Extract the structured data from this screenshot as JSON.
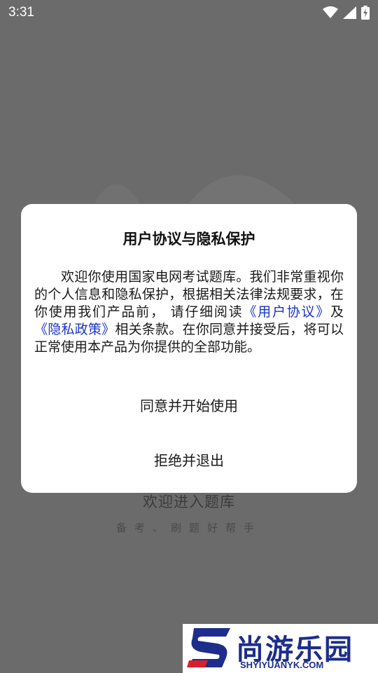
{
  "status_bar": {
    "time": "3:31",
    "icons": [
      "wifi-icon",
      "cellular-signal-icon",
      "battery-charging-icon"
    ]
  },
  "splash": {
    "title": "欢迎进入题库",
    "subtitle": "备考、刷题好帮手"
  },
  "dialog": {
    "title": "用户协议与隐私保护",
    "body_intro": "欢迎你使用国家电网考试题库。我们非常重视你的个人信息和隐私保护，根据相关法律法规要求，在你使用我们产品前， 请仔细阅读",
    "link_user_agreement": "《用户协议》",
    "body_and": "及",
    "link_privacy_policy": "《隐私政策》",
    "body_outro": "相关条款。在你同意并接受后，将可以正常使用本产品为你提供的全部功能。",
    "agree_label": "同意并开始使用",
    "reject_label": "拒绝并退出"
  },
  "watermark": {
    "name": "尚游乐园",
    "url": "SHYIYUANYK.COM"
  },
  "colors": {
    "overlay": "#6b6b6b",
    "link": "#1a35c8",
    "watermark_blue": "#1c2d8c",
    "watermark_red": "#d8202a"
  }
}
